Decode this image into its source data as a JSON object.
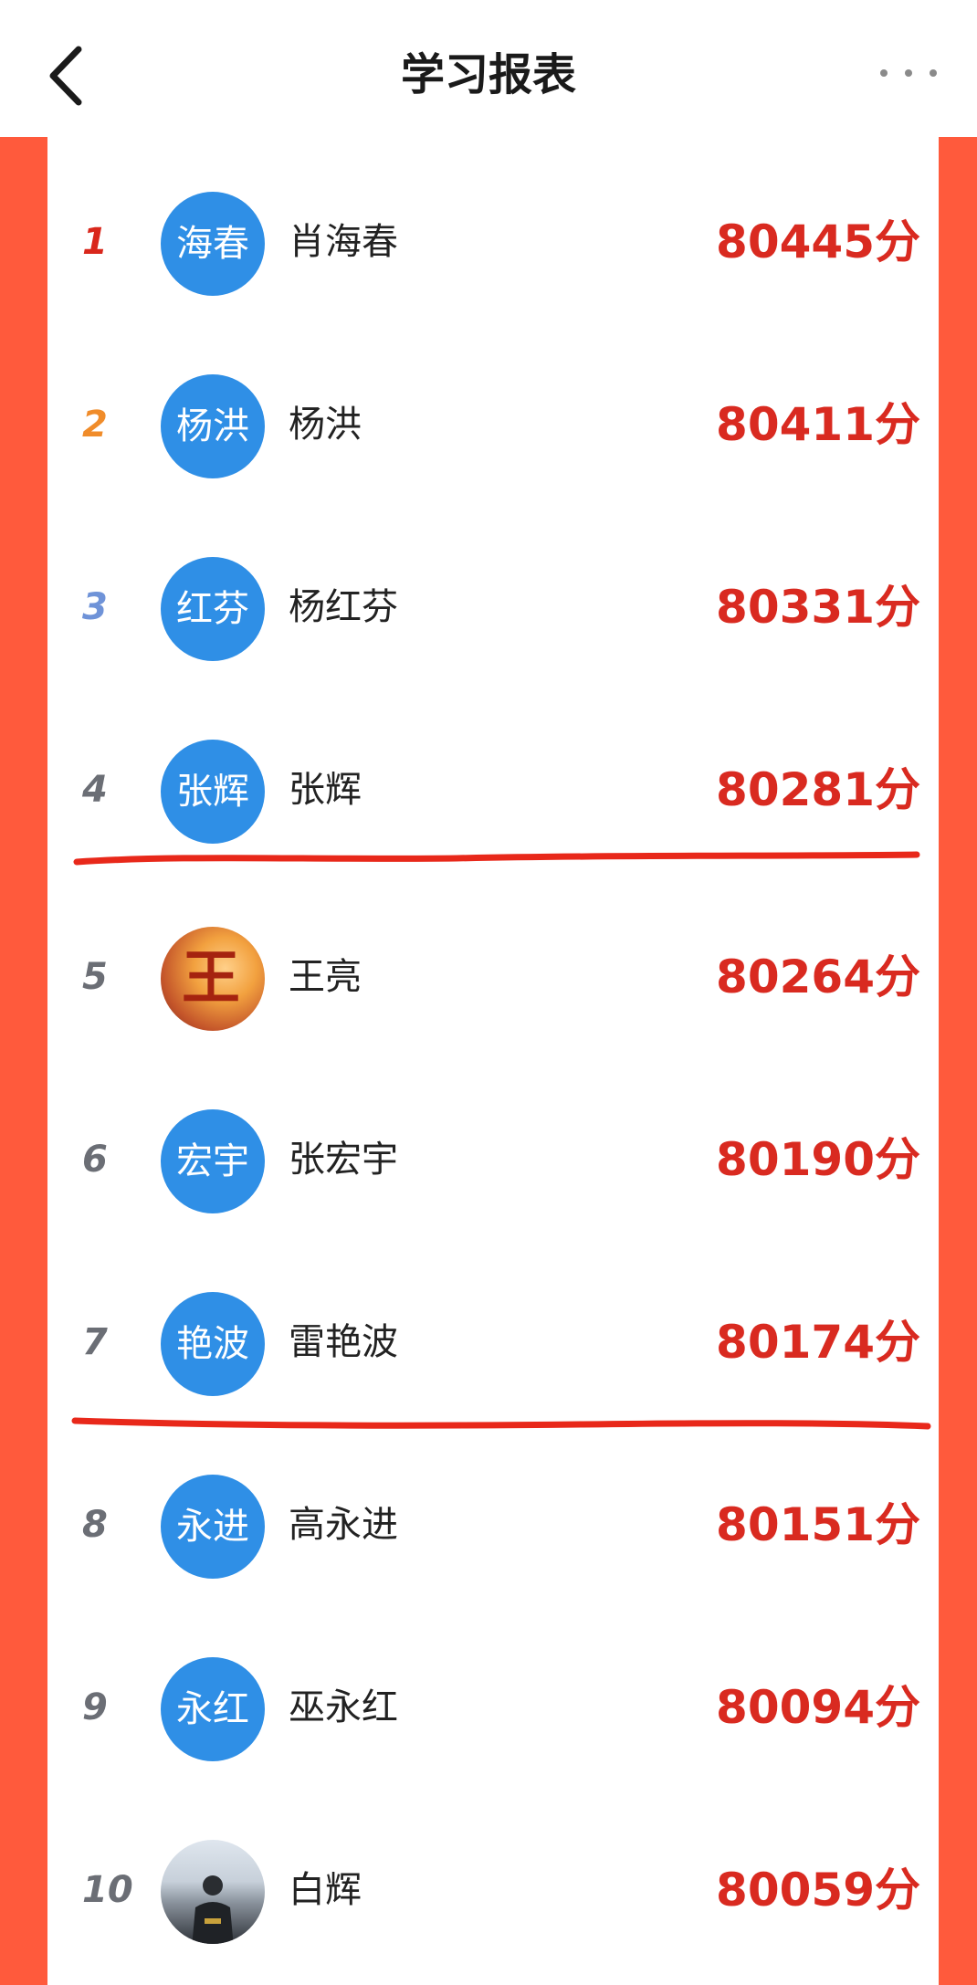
{
  "header": {
    "title": "学习报表"
  },
  "leaderboard": [
    {
      "rank": "1",
      "avatar_text": "海春",
      "name": "肖海春",
      "score": "80445",
      "unit": "分",
      "rank_color": "#d9271c",
      "avatar_type": "text"
    },
    {
      "rank": "2",
      "avatar_text": "杨洪",
      "name": "杨洪",
      "score": "80411",
      "unit": "分",
      "rank_color": "#f08c2a",
      "avatar_type": "text"
    },
    {
      "rank": "3",
      "avatar_text": "红芬",
      "name": "杨红芬",
      "score": "80331",
      "unit": "分",
      "rank_color": "#6f93d8",
      "avatar_type": "text"
    },
    {
      "rank": "4",
      "avatar_text": "张辉",
      "name": "张辉",
      "score": "80281",
      "unit": "分",
      "rank_color": "#6b6e75",
      "avatar_type": "text"
    },
    {
      "rank": "5",
      "avatar_text": "王",
      "name": "王亮",
      "score": "80264",
      "unit": "分",
      "rank_color": "#6b6e75",
      "avatar_type": "image"
    },
    {
      "rank": "6",
      "avatar_text": "宏宇",
      "name": "张宏宇",
      "score": "80190",
      "unit": "分",
      "rank_color": "#6b6e75",
      "avatar_type": "text"
    },
    {
      "rank": "7",
      "avatar_text": "艳波",
      "name": "雷艳波",
      "score": "80174",
      "unit": "分",
      "rank_color": "#6b6e75",
      "avatar_type": "text"
    },
    {
      "rank": "8",
      "avatar_text": "永进",
      "name": "高永进",
      "score": "80151",
      "unit": "分",
      "rank_color": "#6b6e75",
      "avatar_type": "text"
    },
    {
      "rank": "9",
      "avatar_text": "永红",
      "name": "巫永红",
      "score": "80094",
      "unit": "分",
      "rank_color": "#6b6e75",
      "avatar_type": "text"
    },
    {
      "rank": "10",
      "avatar_text": "",
      "name": "白辉",
      "score": "80059",
      "unit": "分",
      "rank_color": "#6b6e75",
      "avatar_type": "photo"
    }
  ],
  "colors": {
    "side_bars": "#ff5a3c",
    "score": "#d92a20",
    "avatar_blue": "#2f8fe6",
    "annotation_line": "#e8281a"
  },
  "icons": {
    "back": "chevron-left-icon",
    "more": "more-dots-icon"
  }
}
